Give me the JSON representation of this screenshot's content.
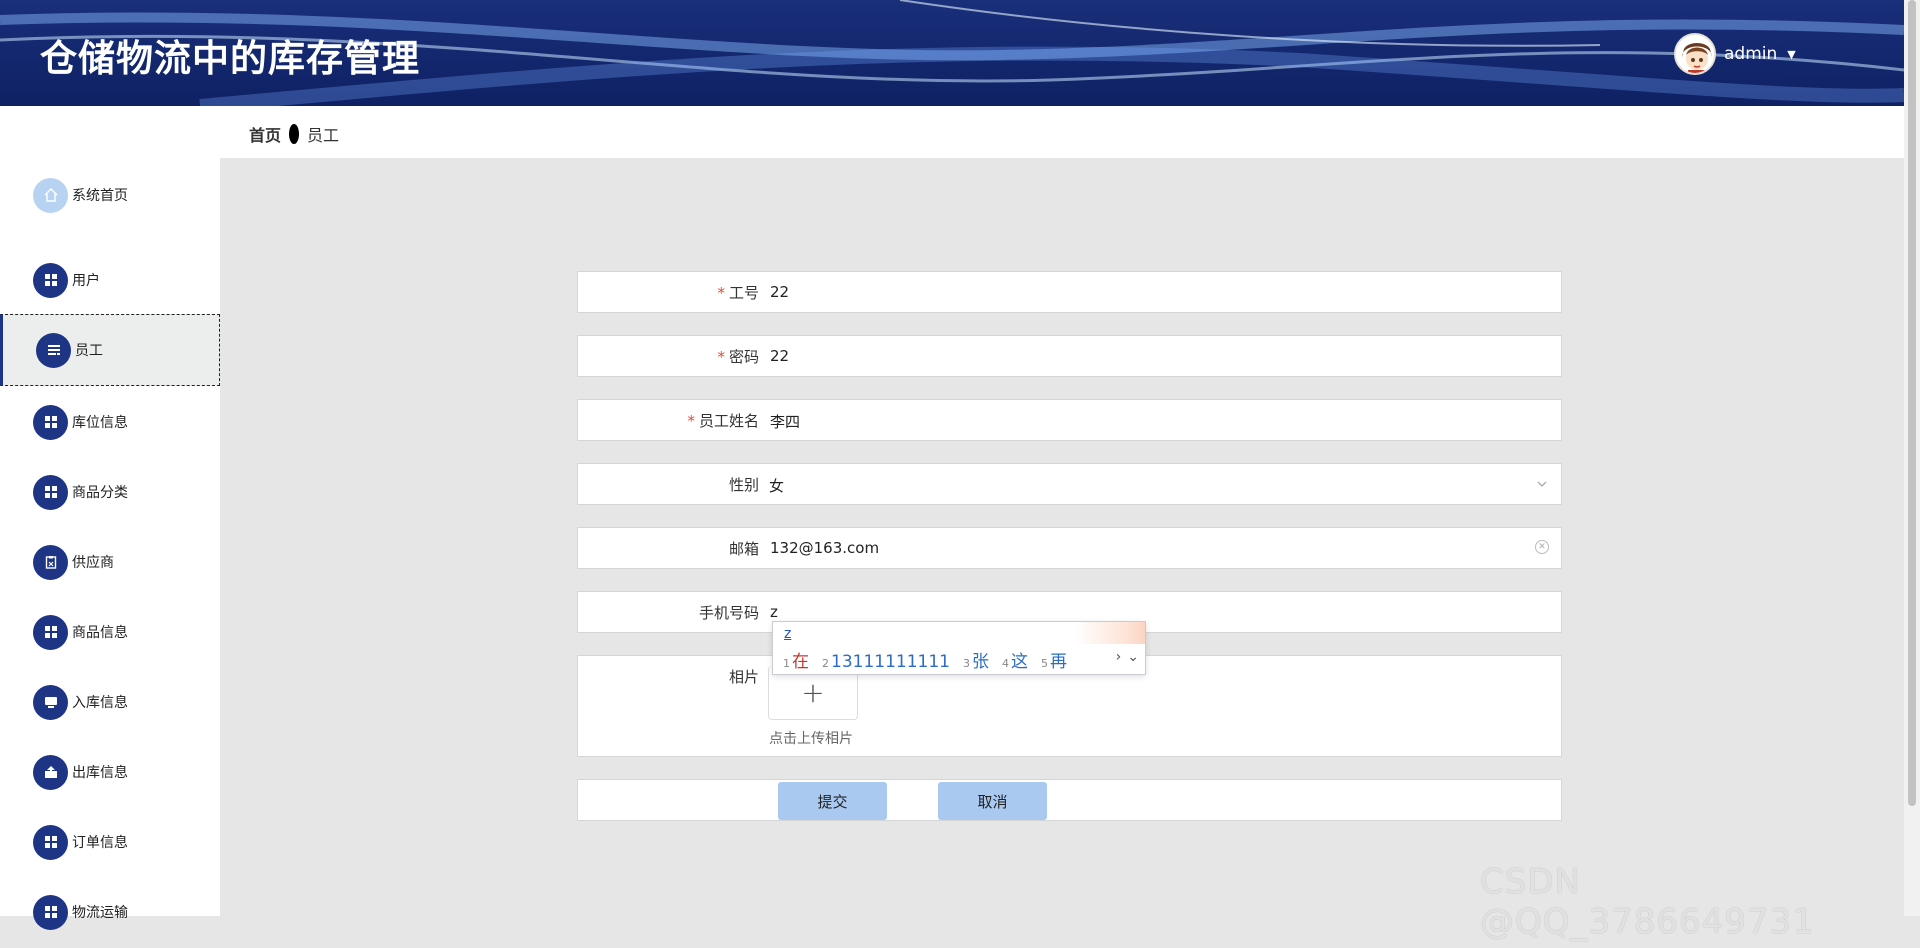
{
  "app": {
    "title": "仓储物流中的库存管理"
  },
  "user": {
    "name": "admin"
  },
  "breadcrumb": {
    "home": "首页",
    "current": "员工"
  },
  "sidebar": {
    "items": [
      {
        "label": "系统首页",
        "icon": "home-icon"
      },
      {
        "label": "用户",
        "icon": "grid-icon"
      },
      {
        "label": "员工",
        "icon": "list-icon",
        "active": true
      },
      {
        "label": "库位信息",
        "icon": "grid-icon"
      },
      {
        "label": "商品分类",
        "icon": "grid-icon"
      },
      {
        "label": "供应商",
        "icon": "clipboard-icon"
      },
      {
        "label": "商品信息",
        "icon": "grid-icon"
      },
      {
        "label": "入库信息",
        "icon": "inbox-icon"
      },
      {
        "label": "出库信息",
        "icon": "export-icon"
      },
      {
        "label": "订单信息",
        "icon": "grid-icon"
      },
      {
        "label": "物流运输",
        "icon": "grid-icon"
      }
    ]
  },
  "form": {
    "job_no": {
      "label": "工号",
      "value": "22",
      "required": true
    },
    "password": {
      "label": "密码",
      "value": "22",
      "required": true
    },
    "name": {
      "label": "员工姓名",
      "value": "李四",
      "required": true
    },
    "gender": {
      "label": "性别",
      "value": "女"
    },
    "email": {
      "label": "邮箱",
      "value": "132@163.com"
    },
    "phone": {
      "label": "手机号码",
      "value": "z"
    },
    "photo": {
      "label": "相片",
      "hint": "点击上传相片"
    },
    "submit_label": "提交",
    "cancel_label": "取消"
  },
  "ime": {
    "composition": "z",
    "candidates": [
      {
        "n": "1",
        "text": "在"
      },
      {
        "n": "2",
        "text": "13111111111"
      },
      {
        "n": "3",
        "text": "张"
      },
      {
        "n": "4",
        "text": "这"
      },
      {
        "n": "5",
        "text": "再"
      }
    ]
  },
  "watermark": "CSDN @QQ_3786649731",
  "colors": {
    "header": "#13276e",
    "accent": "#1d3584",
    "button": "#a9c9f1",
    "required": "#e24b3b"
  }
}
